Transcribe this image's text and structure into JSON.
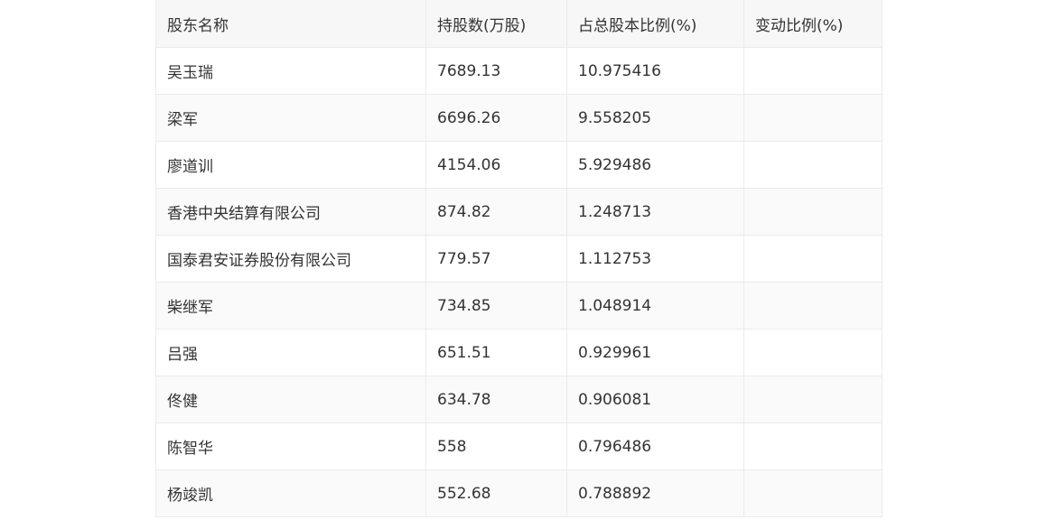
{
  "table": {
    "headers": [
      "股东名称",
      "持股数(万股)",
      "占总股本比例(%)",
      "变动比例(%)"
    ],
    "rows": [
      [
        "吴玉瑞",
        "7689.13",
        "10.975416",
        ""
      ],
      [
        "梁军",
        "6696.26",
        "9.558205",
        ""
      ],
      [
        "廖道训",
        "4154.06",
        "5.929486",
        ""
      ],
      [
        "香港中央结算有限公司",
        "874.82",
        "1.248713",
        ""
      ],
      [
        "国泰君安证券股份有限公司",
        "779.57",
        "1.112753",
        ""
      ],
      [
        "柴继军",
        "734.85",
        "1.048914",
        ""
      ],
      [
        "吕强",
        "651.51",
        "0.929961",
        ""
      ],
      [
        "佟健",
        "634.78",
        "0.906081",
        ""
      ],
      [
        "陈智华",
        "558",
        "0.796486",
        ""
      ],
      [
        "杨竣凯",
        "552.68",
        "0.788892",
        ""
      ]
    ]
  }
}
